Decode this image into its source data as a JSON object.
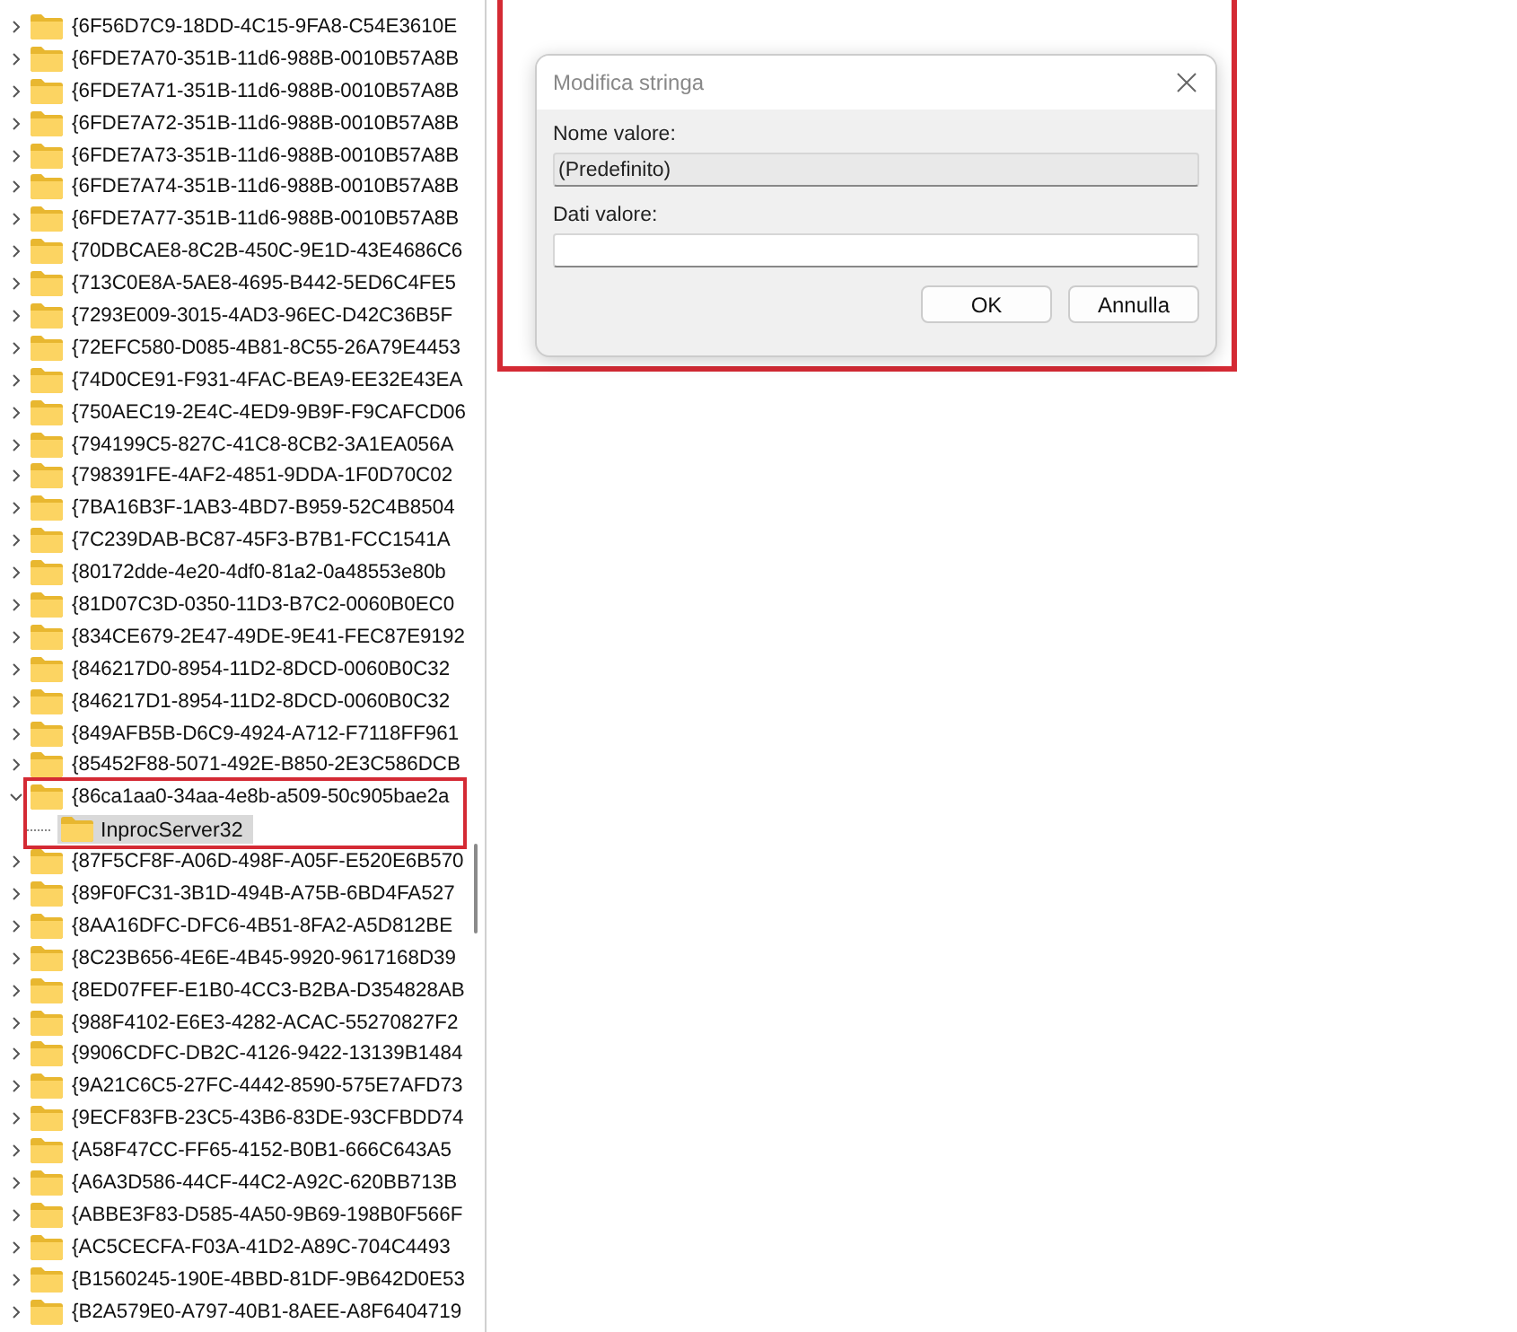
{
  "tree": {
    "items": [
      {
        "label": "{6F56D7C9-18DD-4C15-9FA8-C54E3610E",
        "expanded": false,
        "selected": false,
        "highlighted": false
      },
      {
        "label": "{6FDE7A70-351B-11d6-988B-0010B57A8B",
        "expanded": false,
        "selected": false,
        "highlighted": false
      },
      {
        "label": "{6FDE7A71-351B-11d6-988B-0010B57A8B",
        "expanded": false,
        "selected": false,
        "highlighted": false
      },
      {
        "label": "{6FDE7A72-351B-11d6-988B-0010B57A8B",
        "expanded": false,
        "selected": false,
        "highlighted": false
      },
      {
        "label": "{6FDE7A73-351B-11d6-988B-0010B57A8B",
        "expanded": false,
        "selected": false,
        "highlighted": false
      },
      {
        "label": "{6FDE7A74-351B-11d6-988B-0010B57A8B",
        "expanded": false,
        "selected": false,
        "highlighted": false
      },
      {
        "label": "{6FDE7A77-351B-11d6-988B-0010B57A8B",
        "expanded": false,
        "selected": false,
        "highlighted": false
      },
      {
        "label": "{70DBCAE8-8C2B-450C-9E1D-43E4686C6",
        "expanded": false,
        "selected": false,
        "highlighted": false
      },
      {
        "label": "{713C0E8A-5AE8-4695-B442-5ED6C4FE5",
        "expanded": false,
        "selected": false,
        "highlighted": false
      },
      {
        "label": "{7293E009-3015-4AD3-96EC-D42C36B5F",
        "expanded": false,
        "selected": false,
        "highlighted": false
      },
      {
        "label": "{72EFC580-D085-4B81-8C55-26A79E4453",
        "expanded": false,
        "selected": false,
        "highlighted": false
      },
      {
        "label": "{74D0CE91-F931-4FAC-BEA9-EE32E43EA",
        "expanded": false,
        "selected": false,
        "highlighted": false
      },
      {
        "label": "{750AEC19-2E4C-4ED9-9B9F-F9CAFCD06",
        "expanded": false,
        "selected": false,
        "highlighted": false
      },
      {
        "label": "{794199C5-827C-41C8-8CB2-3A1EA056A",
        "expanded": false,
        "selected": false,
        "highlighted": false
      },
      {
        "label": "{798391FE-4AF2-4851-9DDA-1F0D70C02",
        "expanded": false,
        "selected": false,
        "highlighted": false
      },
      {
        "label": "{7BA16B3F-1AB3-4BD7-B959-52C4B8504",
        "expanded": false,
        "selected": false,
        "highlighted": false
      },
      {
        "label": "{7C239DAB-BC87-45F3-B7B1-FCC1541A",
        "expanded": false,
        "selected": false,
        "highlighted": false
      },
      {
        "label": "{80172dde-4e20-4df0-81a2-0a48553e80b",
        "expanded": false,
        "selected": false,
        "highlighted": false
      },
      {
        "label": "{81D07C3D-0350-11D3-B7C2-0060B0EC0",
        "expanded": false,
        "selected": false,
        "highlighted": false
      },
      {
        "label": "{834CE679-2E47-49DE-9E41-FEC87E9192",
        "expanded": false,
        "selected": false,
        "highlighted": false
      },
      {
        "label": "{846217D0-8954-11D2-8DCD-0060B0C32",
        "expanded": false,
        "selected": false,
        "highlighted": false
      },
      {
        "label": "{846217D1-8954-11D2-8DCD-0060B0C32",
        "expanded": false,
        "selected": false,
        "highlighted": false
      },
      {
        "label": "{849AFB5B-D6C9-4924-A712-F7118FF961",
        "expanded": false,
        "selected": false,
        "highlighted": false
      },
      {
        "label": "{85452F88-5071-492E-B850-2E3C586DCB",
        "expanded": false,
        "selected": false,
        "highlighted": false
      },
      {
        "label": "{86ca1aa0-34aa-4e8b-a509-50c905bae2a",
        "expanded": true,
        "selected": false,
        "highlighted": true,
        "children": [
          {
            "label": "InprocServer32",
            "selected": true
          }
        ]
      },
      {
        "label": "{87F5CF8F-A06D-498F-A05F-E520E6B570",
        "expanded": false,
        "selected": false,
        "highlighted": false
      },
      {
        "label": "{89F0FC31-3B1D-494B-A75B-6BD4FA527",
        "expanded": false,
        "selected": false,
        "highlighted": false
      },
      {
        "label": "{8AA16DFC-DFC6-4B51-8FA2-A5D812BE",
        "expanded": false,
        "selected": false,
        "highlighted": false
      },
      {
        "label": "{8C23B656-4E6E-4B45-9920-9617168D39",
        "expanded": false,
        "selected": false,
        "highlighted": false
      },
      {
        "label": "{8ED07FEF-E1B0-4CC3-B2BA-D354828AB",
        "expanded": false,
        "selected": false,
        "highlighted": false
      },
      {
        "label": "{988F4102-E6E3-4282-ACAC-55270827F2",
        "expanded": false,
        "selected": false,
        "highlighted": false
      },
      {
        "label": "{9906CDFC-DB2C-4126-9422-13139B1484",
        "expanded": false,
        "selected": false,
        "highlighted": false
      },
      {
        "label": "{9A21C6C5-27FC-4442-8590-575E7AFD73",
        "expanded": false,
        "selected": false,
        "highlighted": false
      },
      {
        "label": "{9ECF83FB-23C5-43B6-83DE-93CFBDD74",
        "expanded": false,
        "selected": false,
        "highlighted": false
      },
      {
        "label": "{A58F47CC-FF65-4152-B0B1-666C643A5",
        "expanded": false,
        "selected": false,
        "highlighted": false
      },
      {
        "label": "{A6A3D586-44CF-44C2-A92C-620BB713B",
        "expanded": false,
        "selected": false,
        "highlighted": false
      },
      {
        "label": "{ABBE3F83-D585-4A50-9B69-198B0F566F",
        "expanded": false,
        "selected": false,
        "highlighted": false
      },
      {
        "label": "{AC5CECFA-F03A-41D2-A89C-704C4493",
        "expanded": false,
        "selected": false,
        "highlighted": false
      },
      {
        "label": "{B1560245-190E-4BBD-81DF-9B642D0E53",
        "expanded": false,
        "selected": false,
        "highlighted": false
      },
      {
        "label": "{B2A579E0-A797-40B1-8AEE-A8F6404719",
        "expanded": false,
        "selected": false,
        "highlighted": false
      }
    ]
  },
  "dialog": {
    "title": "Modifica stringa",
    "highlighted": true,
    "fields": [
      {
        "label": "Nome valore:",
        "value": "(Predefinito)",
        "readonly": true
      },
      {
        "label": "Dati valore:",
        "readonly": false
      }
    ],
    "buttons": [
      "OK",
      "Annulla"
    ]
  }
}
